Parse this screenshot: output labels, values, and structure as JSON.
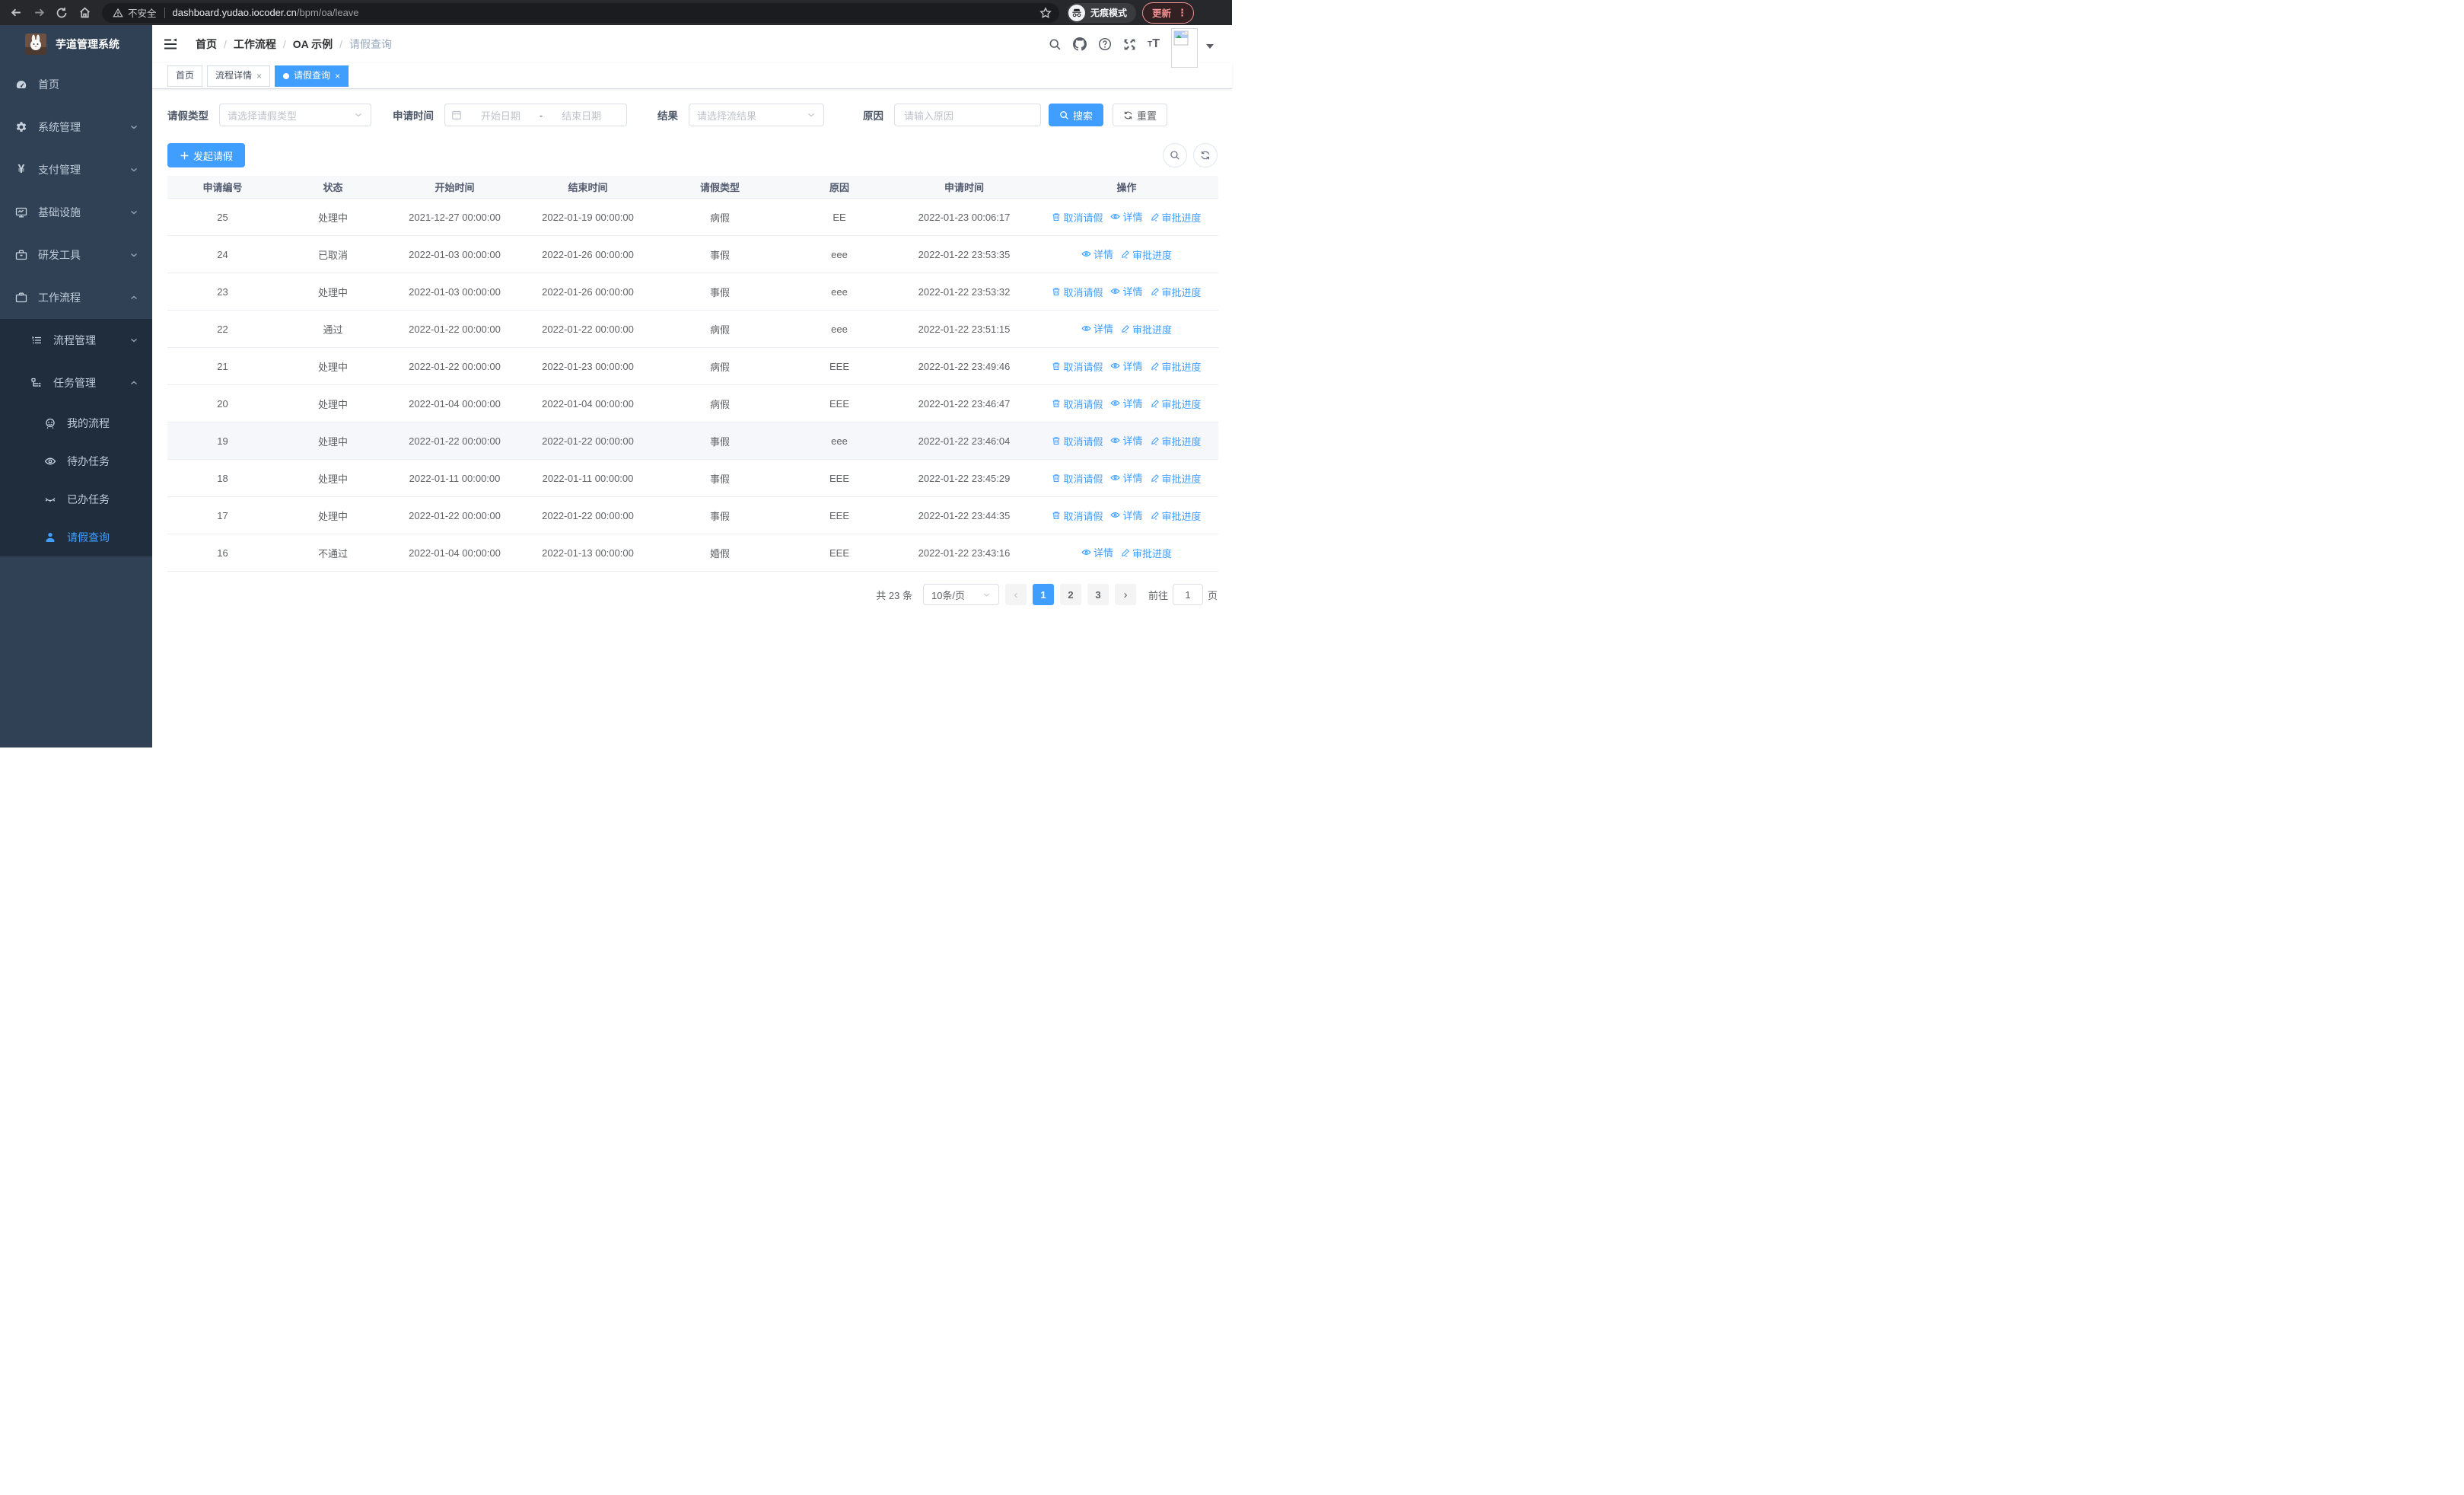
{
  "colors": {
    "accent": "#409eff",
    "sidebar_bg": "#304156",
    "submenu_bg": "#1f2d3d",
    "table_header_bg": "#f7f8fa",
    "row_hover": "#f5f7fa"
  },
  "browser": {
    "security_chip": "不安全",
    "url_host": "dashboard.yudao.iocoder.cn",
    "url_path": "/bpm/oa/leave",
    "incognito_label": "无痕模式",
    "update_button": "更新"
  },
  "sidebar": {
    "app_title": "芋道管理系统",
    "items": [
      {
        "label": "首页",
        "icon": "dashboard-icon"
      },
      {
        "label": "系统管理",
        "icon": "gear-icon"
      },
      {
        "label": "支付管理",
        "icon": "yen-icon"
      },
      {
        "label": "基础设施",
        "icon": "monitor-icon"
      },
      {
        "label": "研发工具",
        "icon": "toolbox-icon"
      },
      {
        "label": "工作流程",
        "icon": "briefcase-icon"
      },
      {
        "label": "流程管理",
        "icon": "list-icon"
      },
      {
        "label": "任务管理",
        "icon": "tree-icon"
      },
      {
        "label": "我的流程",
        "icon": "robot-icon"
      },
      {
        "label": "待办任务",
        "icon": "eye-open-icon"
      },
      {
        "label": "已办任务",
        "icon": "eye-closed-icon"
      },
      {
        "label": "请假查询",
        "icon": "user-icon"
      }
    ]
  },
  "header": {
    "breadcrumb": [
      "首页",
      "工作流程",
      "OA 示例",
      "请假查询"
    ]
  },
  "tabs": [
    {
      "label": "首页"
    },
    {
      "label": "流程详情"
    },
    {
      "label": "请假查询"
    }
  ],
  "filters": {
    "leave_type_label": "请假类型",
    "leave_type_placeholder": "请选择请假类型",
    "apply_time_label": "申请时间",
    "date_start_placeholder": "开始日期",
    "date_separator": "-",
    "date_end_placeholder": "结束日期",
    "result_label": "结果",
    "result_placeholder": "请选择流结果",
    "reason_label": "原因",
    "reason_placeholder": "请输入原因",
    "search_button": "搜索",
    "reset_button": "重置"
  },
  "toolbar": {
    "create_button": "发起请假"
  },
  "table": {
    "columns": [
      "申请编号",
      "状态",
      "开始时间",
      "结束时间",
      "请假类型",
      "原因",
      "申请时间",
      "操作"
    ],
    "action_labels": {
      "cancel": "取消请假",
      "detail": "详情",
      "progress": "审批进度"
    },
    "rows": [
      {
        "id": "25",
        "status": "处理中",
        "start": "2021-12-27 00:00:00",
        "end": "2022-01-19 00:00:00",
        "type": "病假",
        "reason": "EE",
        "applied": "2022-01-23 00:06:17",
        "actions": [
          "cancel",
          "detail",
          "progress"
        ],
        "highlight": false
      },
      {
        "id": "24",
        "status": "已取消",
        "start": "2022-01-03 00:00:00",
        "end": "2022-01-26 00:00:00",
        "type": "事假",
        "reason": "eee",
        "applied": "2022-01-22 23:53:35",
        "actions": [
          "detail",
          "progress"
        ],
        "highlight": false
      },
      {
        "id": "23",
        "status": "处理中",
        "start": "2022-01-03 00:00:00",
        "end": "2022-01-26 00:00:00",
        "type": "事假",
        "reason": "eee",
        "applied": "2022-01-22 23:53:32",
        "actions": [
          "cancel",
          "detail",
          "progress"
        ],
        "highlight": false
      },
      {
        "id": "22",
        "status": "通过",
        "start": "2022-01-22 00:00:00",
        "end": "2022-01-22 00:00:00",
        "type": "病假",
        "reason": "eee",
        "applied": "2022-01-22 23:51:15",
        "actions": [
          "detail",
          "progress"
        ],
        "highlight": false
      },
      {
        "id": "21",
        "status": "处理中",
        "start": "2022-01-22 00:00:00",
        "end": "2022-01-23 00:00:00",
        "type": "病假",
        "reason": "EEE",
        "applied": "2022-01-22 23:49:46",
        "actions": [
          "cancel",
          "detail",
          "progress"
        ],
        "highlight": false
      },
      {
        "id": "20",
        "status": "处理中",
        "start": "2022-01-04 00:00:00",
        "end": "2022-01-04 00:00:00",
        "type": "病假",
        "reason": "EEE",
        "applied": "2022-01-22 23:46:47",
        "actions": [
          "cancel",
          "detail",
          "progress"
        ],
        "highlight": false
      },
      {
        "id": "19",
        "status": "处理中",
        "start": "2022-01-22 00:00:00",
        "end": "2022-01-22 00:00:00",
        "type": "事假",
        "reason": "eee",
        "applied": "2022-01-22 23:46:04",
        "actions": [
          "cancel",
          "detail",
          "progress"
        ],
        "highlight": true
      },
      {
        "id": "18",
        "status": "处理中",
        "start": "2022-01-11 00:00:00",
        "end": "2022-01-11 00:00:00",
        "type": "事假",
        "reason": "EEE",
        "applied": "2022-01-22 23:45:29",
        "actions": [
          "cancel",
          "detail",
          "progress"
        ],
        "highlight": false
      },
      {
        "id": "17",
        "status": "处理中",
        "start": "2022-01-22 00:00:00",
        "end": "2022-01-22 00:00:00",
        "type": "事假",
        "reason": "EEE",
        "applied": "2022-01-22 23:44:35",
        "actions": [
          "cancel",
          "detail",
          "progress"
        ],
        "highlight": false
      },
      {
        "id": "16",
        "status": "不通过",
        "start": "2022-01-04 00:00:00",
        "end": "2022-01-13 00:00:00",
        "type": "婚假",
        "reason": "EEE",
        "applied": "2022-01-22 23:43:16",
        "actions": [
          "detail",
          "progress"
        ],
        "highlight": false
      }
    ]
  },
  "pagination": {
    "total_text": "共 23 条",
    "page_size": "10条/页",
    "pages": [
      "1",
      "2",
      "3"
    ],
    "active_page": "1",
    "goto_label": "前往",
    "goto_value": "1",
    "goto_suffix": "页"
  }
}
